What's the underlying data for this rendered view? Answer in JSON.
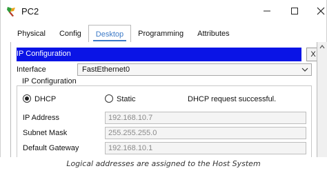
{
  "window": {
    "title": "PC2",
    "icon": "pc-app-icon",
    "controls": {
      "minimize": "minimize-icon",
      "maximize": "maximize-icon",
      "close": "close-icon"
    }
  },
  "tabs": [
    {
      "label": "Physical",
      "active": false
    },
    {
      "label": "Config",
      "active": false
    },
    {
      "label": "Desktop",
      "active": true
    },
    {
      "label": "Programming",
      "active": false
    },
    {
      "label": "Attributes",
      "active": false
    }
  ],
  "ip_configuration": {
    "header": "IP Configuration",
    "close_label": "X",
    "interface_label": "Interface",
    "interface_value": "FastEthernet0",
    "group_title": "IP Configuration",
    "dhcp_label": "DHCP",
    "static_label": "Static",
    "mode_selected": "DHCP",
    "status": "DHCP request successful.",
    "fields": {
      "ip_address": {
        "label": "IP Address",
        "value": "192.168.10.7"
      },
      "subnet_mask": {
        "label": "Subnet Mask",
        "value": "255.255.255.0"
      },
      "default_gateway": {
        "label": "Default Gateway",
        "value": "192.168.10.1"
      }
    }
  },
  "colors": {
    "header_bg": "#0a14e6",
    "active_tab": "#3b79c7"
  },
  "caption": "Logical addresses are assigned to the Host System"
}
